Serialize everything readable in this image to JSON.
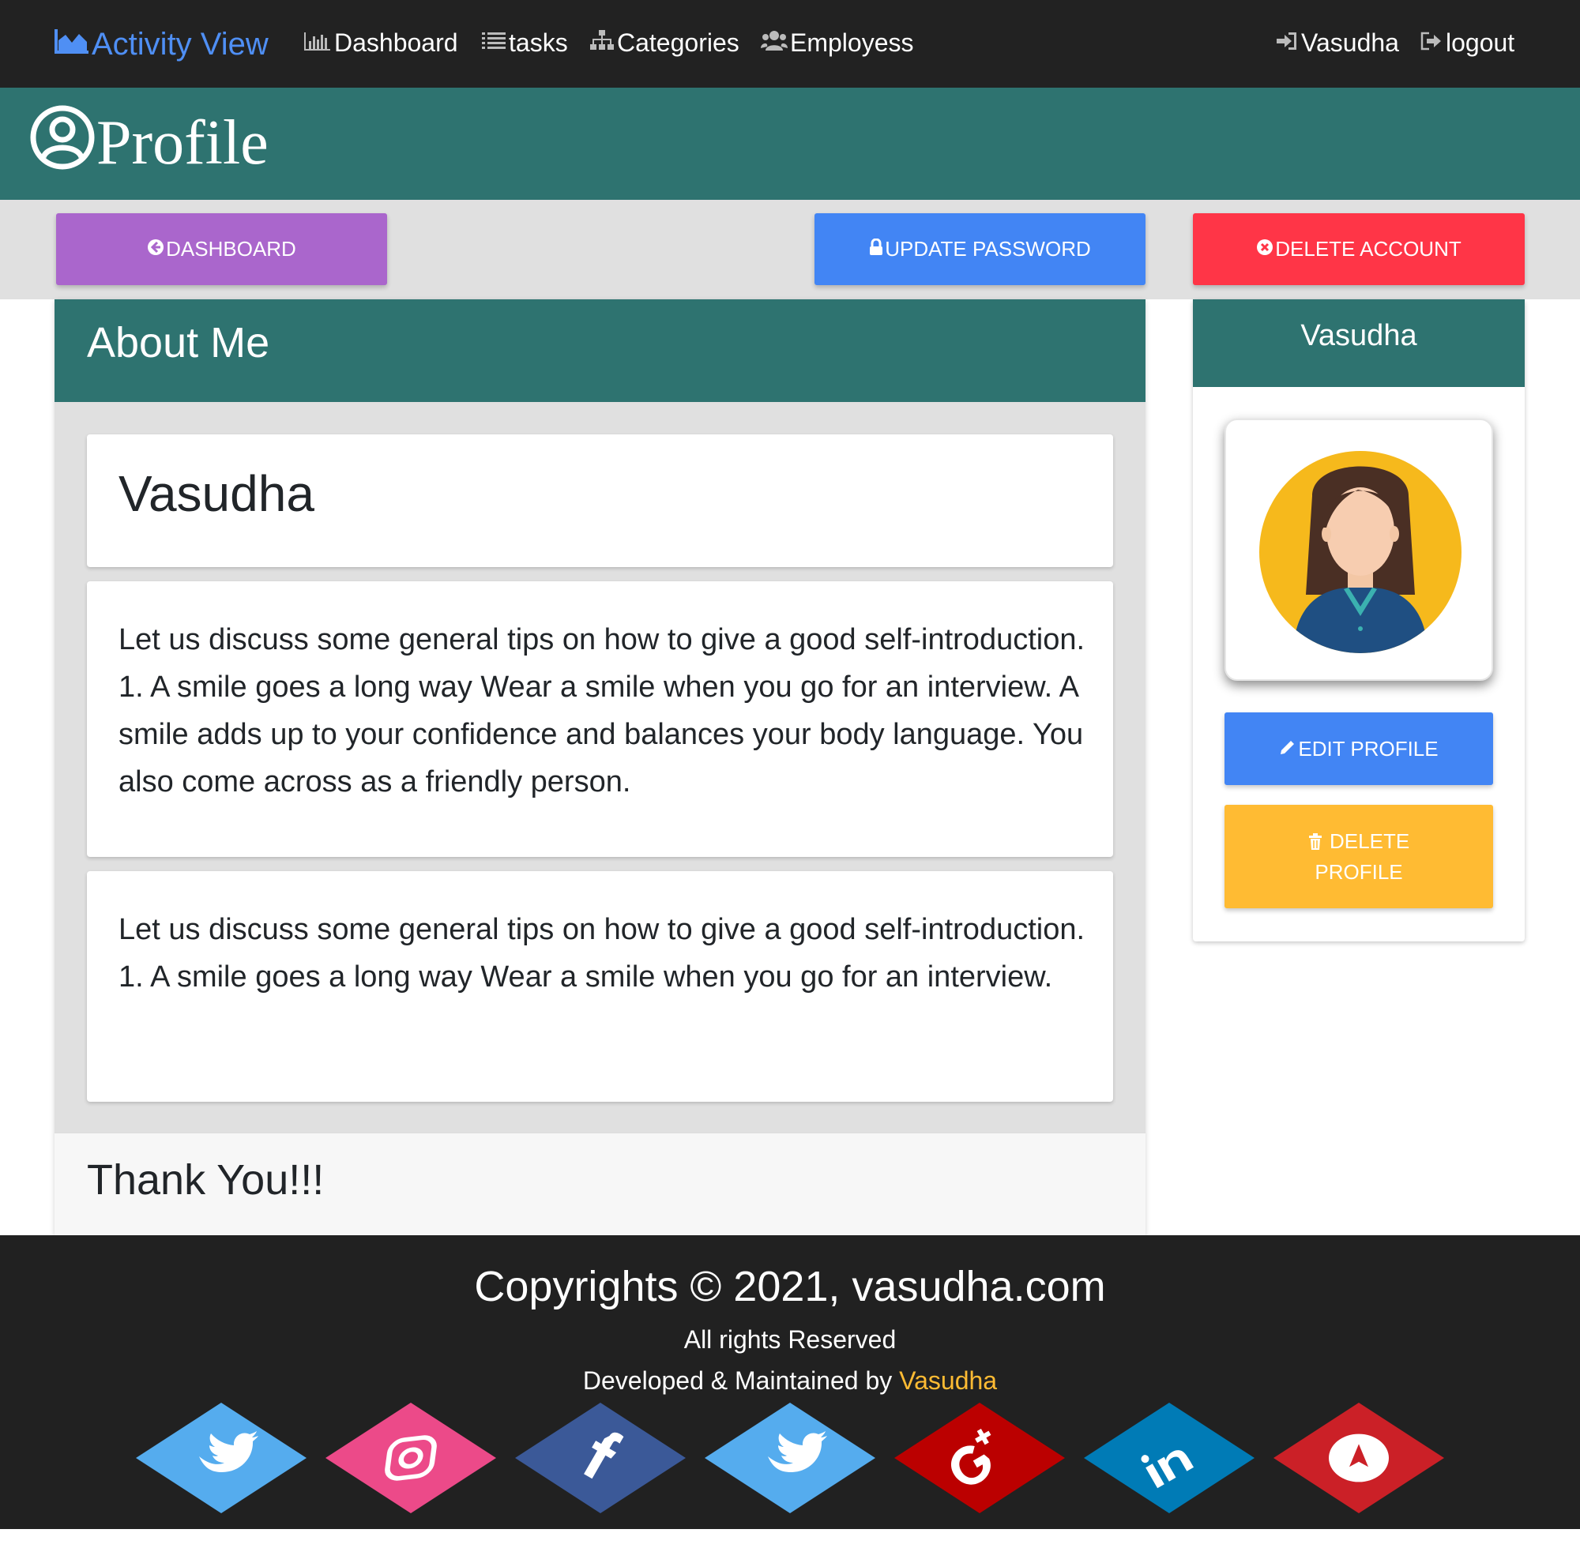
{
  "navbar": {
    "brand": "Activity View",
    "links": {
      "dashboard": "Dashboard",
      "tasks": "tasks",
      "categories": "Categories",
      "employess": "Employess"
    },
    "user": "Vasudha",
    "logout": "logout"
  },
  "page": {
    "title": "Profile"
  },
  "actions": {
    "dashboard": "DASHBOARD",
    "update_password": "UPDATE PASSWORD",
    "delete_account": "DELETE ACCOUNT"
  },
  "about": {
    "heading": "About Me",
    "name": "Vasudha",
    "paragraph1": "Let us discuss some general tips on how to give a good self-introduction. 1. A smile goes a long way Wear a smile when you go for an interview. A smile adds up to your confidence and balances your body language. You also come across as a friendly person.",
    "paragraph2": "Let us discuss some general tips on how to give a good self-introduction. 1. A smile goes a long way Wear a smile when you go for an interview.",
    "footer": "Thank You!!!"
  },
  "side": {
    "name": "Vasudha",
    "edit_profile": "EDIT PROFILE",
    "delete_profile": "DELETE PROFILE"
  },
  "footer": {
    "copyright": "Copyrights © 2021, vasudha.com",
    "rights": "All rights Reserved",
    "developed_prefix": "Developed & Maintained by",
    "developer": "Vasudha",
    "social": [
      {
        "icon": "twitter-icon",
        "color": "#55acee"
      },
      {
        "icon": "instagram-icon",
        "color": "#ec4a89"
      },
      {
        "icon": "facebook-icon",
        "color": "#3b5998"
      },
      {
        "icon": "twitter-icon",
        "color": "#55acee"
      },
      {
        "icon": "google-plus-icon",
        "color": "#bb0000"
      },
      {
        "icon": "linkedin-icon",
        "color": "#007bb6"
      },
      {
        "icon": "pinterest-icon",
        "color": "#cb2027"
      }
    ]
  },
  "colors": {
    "navbar": "#222222",
    "teal": "#2e7370",
    "purple": "#aa66cc",
    "blue": "#4285f4",
    "red": "#ff3547",
    "amber": "#ffbb33",
    "brand": "#4f8ff4"
  }
}
